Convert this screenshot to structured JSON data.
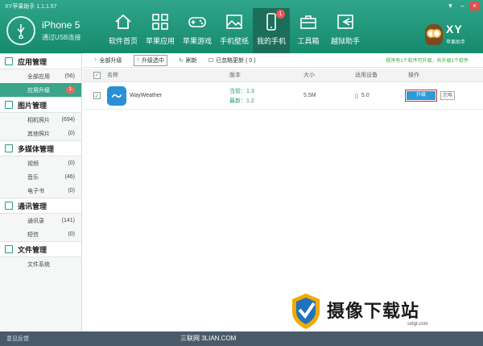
{
  "window": {
    "title": "XY苹果助手 1.1.1.57"
  },
  "device": {
    "name": "iPhone 5",
    "connection": "通过USB连接"
  },
  "nav": [
    {
      "label": "软件首页",
      "icon": "home-icon"
    },
    {
      "label": "苹果应用",
      "icon": "apps-grid-icon"
    },
    {
      "label": "苹果游戏",
      "icon": "gamepad-icon"
    },
    {
      "label": "手机壁纸",
      "icon": "image-icon"
    },
    {
      "label": "我的手机",
      "icon": "phone-icon",
      "badge": "1",
      "active": true
    },
    {
      "label": "工具箱",
      "icon": "toolbox-icon"
    },
    {
      "label": "越狱助手",
      "icon": "jailbreak-icon"
    }
  ],
  "brand": {
    "logo": "XY",
    "sub": "苹果助手"
  },
  "sidebar": {
    "sections": [
      {
        "title": "应用管理",
        "icon": "apps-icon",
        "items": [
          {
            "label": "全部应用",
            "count": "(56)"
          },
          {
            "label": "应用升级",
            "count": "1",
            "active": true
          }
        ]
      },
      {
        "title": "图片管理",
        "icon": "picture-icon",
        "items": [
          {
            "label": "相机照片",
            "count": "(694)"
          },
          {
            "label": "其他照片",
            "count": "(0)"
          }
        ]
      },
      {
        "title": "多媒体管理",
        "icon": "media-icon",
        "items": [
          {
            "label": "视频",
            "count": "(0)"
          },
          {
            "label": "音乐",
            "count": "(46)"
          },
          {
            "label": "电子书",
            "count": "(0)"
          }
        ]
      },
      {
        "title": "通讯管理",
        "icon": "contacts-icon",
        "items": [
          {
            "label": "通讯录",
            "count": "(141)"
          },
          {
            "label": "短信",
            "count": "(0)"
          }
        ]
      },
      {
        "title": "文件管理",
        "icon": "folder-icon",
        "items": [
          {
            "label": "文件系统",
            "count": ""
          }
        ]
      }
    ]
  },
  "toolbar": {
    "all_upgrade": "全部升级",
    "upgrade_selected": "升级选中",
    "refresh": "刷新",
    "ignored": "已忽略更新 ( 0 )",
    "note": "程序有1个软件可升级，共升级1个软件"
  },
  "table": {
    "headers": {
      "name": "名称",
      "version": "版本",
      "size": "大小",
      "device": "适用设备",
      "action": "操作"
    },
    "rows": [
      {
        "name": "WayWeather",
        "version_current": "当前：1.3",
        "version_latest": "最新：1.2",
        "size": "5.5M",
        "device": "5.0",
        "action_upgrade": "升级",
        "action_ignore": "忽略"
      }
    ]
  },
  "footer": {
    "feedback": "意见反馈",
    "site": "三联网 3LIAN.COM"
  },
  "watermark": {
    "text": "摄像下载站",
    "url": "sxtgr.com"
  }
}
